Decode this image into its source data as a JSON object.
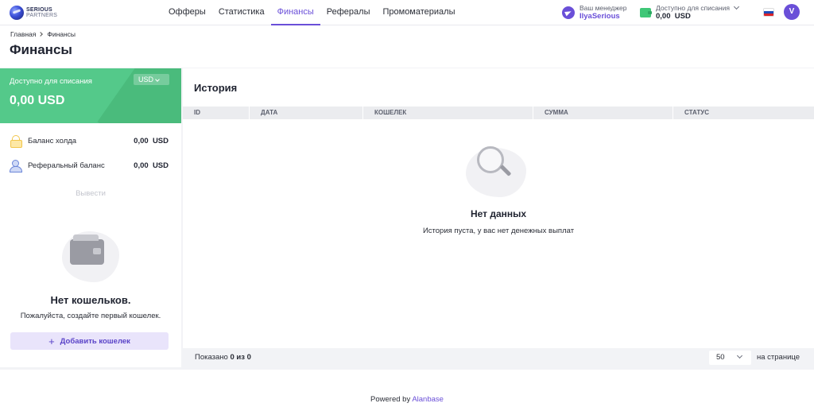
{
  "logo": {
    "line1": "SERIOUS",
    "line2": "PARTNERS"
  },
  "nav": {
    "items": [
      {
        "label": "Офферы",
        "active": false
      },
      {
        "label": "Статистика",
        "active": false
      },
      {
        "label": "Финансы",
        "active": true
      },
      {
        "label": "Рефералы",
        "active": false
      },
      {
        "label": "Промоматериалы",
        "active": false
      }
    ]
  },
  "manager": {
    "label": "Ваш менеджер",
    "name": "IlyaSerious",
    "icon": "telegram-icon"
  },
  "header_balance": {
    "label": "Доступно для списания",
    "value": "0,00  USD",
    "icon": "wallet-icon"
  },
  "language": {
    "icon": "russia-flag-icon"
  },
  "user": {
    "initial": "V"
  },
  "breadcrumb": {
    "home": "Главная",
    "current": "Финансы"
  },
  "page_title": "Финансы",
  "balance_card": {
    "label": "Доступно для списания",
    "amount": "0,00 USD",
    "currency": "USD",
    "accent": "#54c98a"
  },
  "balances": [
    {
      "name": "Баланс холда",
      "value": "0,00  USD",
      "icon": "lock-icon"
    },
    {
      "name": "Реферальный баланс",
      "value": "0,00  USD",
      "icon": "referral-icon"
    }
  ],
  "withdraw_label": "Вывести",
  "wallets_empty": {
    "title": "Нет кошельков.",
    "subtitle": "Пожалуйста, создайте первый кошелек.",
    "add_label": "Добавить кошелек"
  },
  "history": {
    "title": "История",
    "columns": [
      "ID",
      "ДАТА",
      "КОШЕЛЕК",
      "СУММА",
      "СТАТУС"
    ],
    "rows": [],
    "empty_title": "Нет данных",
    "empty_subtitle": "История пуста, у вас нет денежных выплат",
    "shown_prefix": "Показано",
    "shown_value": "0 из 0",
    "per_page": "50",
    "per_page_label": "на странице"
  },
  "footer": {
    "powered_prefix": "Powered by",
    "brand": "Alanbase"
  },
  "colors": {
    "accent": "#6a4fd8",
    "success": "#54c98a"
  }
}
